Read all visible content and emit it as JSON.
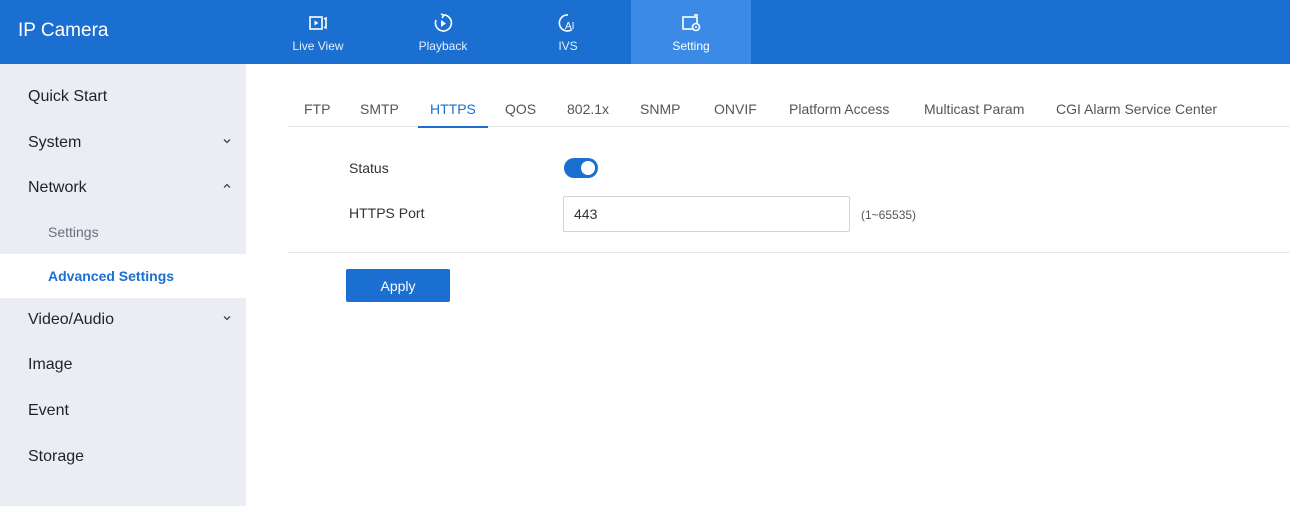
{
  "header": {
    "app_title": "IP Camera",
    "nav": [
      {
        "label": "Live View",
        "icon": "live-view-icon"
      },
      {
        "label": "Playback",
        "icon": "playback-icon"
      },
      {
        "label": "IVS",
        "icon": "ai-icon"
      },
      {
        "label": "Setting",
        "icon": "setting-icon",
        "active": true
      }
    ]
  },
  "sidebar": {
    "items": [
      {
        "label": "Quick Start"
      },
      {
        "label": "System",
        "chevron": "down"
      },
      {
        "label": "Network",
        "chevron": "up"
      },
      {
        "label": "Settings"
      },
      {
        "label": "Advanced Settings",
        "active": true
      },
      {
        "label": "Video/Audio",
        "chevron": "down"
      },
      {
        "label": "Image"
      },
      {
        "label": "Event"
      },
      {
        "label": "Storage"
      }
    ]
  },
  "tabs": [
    {
      "label": "FTP"
    },
    {
      "label": "SMTP"
    },
    {
      "label": "HTTPS",
      "active": true
    },
    {
      "label": "QOS"
    },
    {
      "label": "802.1x"
    },
    {
      "label": "SNMP"
    },
    {
      "label": "ONVIF"
    },
    {
      "label": "Platform Access"
    },
    {
      "label": "Multicast Param"
    },
    {
      "label": "CGI Alarm Service Center"
    }
  ],
  "form": {
    "status_label": "Status",
    "status_enabled": true,
    "port_label": "HTTPS Port",
    "port_value": "443",
    "port_range": "(1~65535)",
    "apply_label": "Apply"
  },
  "colors": {
    "brand": "#1a6fd0",
    "sidebar_bg": "#eaedf4"
  }
}
